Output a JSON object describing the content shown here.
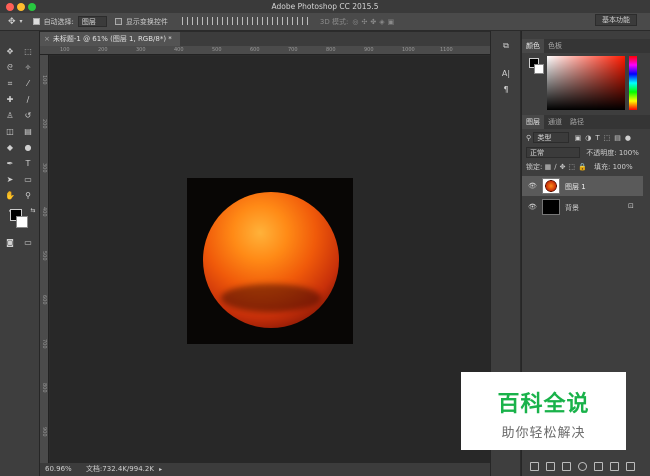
{
  "app_title": "Adobe Photoshop CC 2015.5",
  "options_bar": {
    "auto_select_label": "自动选择:",
    "auto_select_value": "图层",
    "show_transform_label": "显示变换控件",
    "mode_3d_label": "3D 模式:",
    "workspace": "基本功能"
  },
  "document": {
    "tab_title": "未标题-1 @ 61% (图层 1, RGB/8*) *"
  },
  "rulers": {
    "top": [
      "100",
      "200",
      "300",
      "400",
      "500",
      "600",
      "700",
      "800",
      "900",
      "1000",
      "1100"
    ],
    "left": [
      "100",
      "200",
      "300",
      "400",
      "500",
      "600",
      "700",
      "800",
      "900"
    ]
  },
  "status": {
    "zoom": "60.96%",
    "doc_size": "文档:732.4K/994.2K"
  },
  "color_panel": {
    "tabs": [
      "颜色",
      "色板"
    ]
  },
  "layers_panel": {
    "tabs": [
      "图层",
      "通道",
      "路径"
    ],
    "filter_label": "类型",
    "blend_mode": "正常",
    "opacity_label": "不透明度:",
    "opacity_value": "100%",
    "lock_label": "锁定:",
    "fill_label": "填充:",
    "fill_value": "100%",
    "layers": [
      {
        "name": "图层 1",
        "selected": true
      },
      {
        "name": "背景",
        "selected": false
      }
    ]
  },
  "watermark": {
    "main": "百科全说",
    "sub": "助你轻松解决"
  },
  "colors": {
    "accent_green": "#19b24a",
    "panel_bg": "#3e3e3e",
    "canvas_bg": "#282828"
  }
}
